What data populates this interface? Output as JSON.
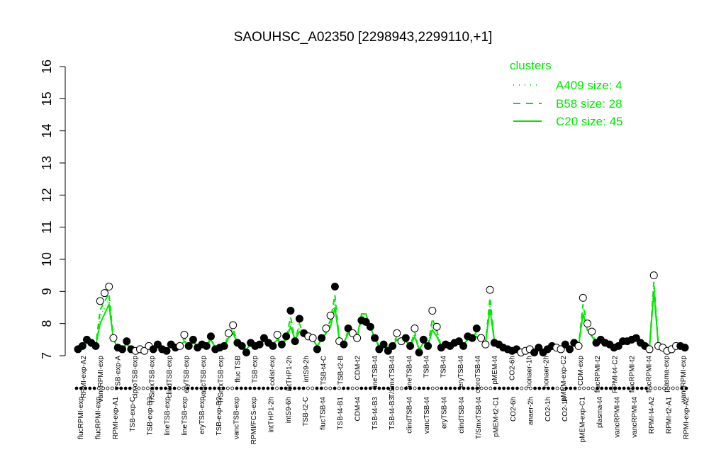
{
  "chart_data": {
    "type": "line",
    "title": "SAOUHSC_A02350 [2298943,2299110,+1]",
    "xlabel": "",
    "ylabel": "",
    "ylim": [
      7,
      16
    ],
    "y_ticks": [
      7,
      8,
      9,
      10,
      11,
      12,
      13,
      14,
      15,
      16
    ],
    "grid": false,
    "legend": {
      "position": "top-right",
      "title": "clusters",
      "entries": [
        {
          "label": "A409 size: 4",
          "style": "dotted"
        },
        {
          "label": "B58 size: 28",
          "style": "dashed"
        },
        {
          "label": "C20 size: 45",
          "style": "solid"
        }
      ]
    },
    "series_color": "#00e600",
    "top_labels": [
      "RPMI-exp-A2",
      "vancRPMI-exp",
      "TSB-exp-A",
      "ciproTSB-exp",
      "T/SmxTSB-exp",
      "clindTSB-exp",
      "eryTSB-exp",
      "vancTSB-exp",
      "T/SmxTSB-exp",
      "fluc TSB",
      "TSB-exp",
      "colist-exp",
      "intTHP1-2h",
      "intS9-2h",
      "TSB-t4-C",
      "TSB-t2-B",
      "CDM-t2",
      "lineTSB-t4",
      "T/SmxTSB-t4",
      "lineTSB-t4",
      "TSB-t4",
      "TSB-t4",
      "eryTSB-t4",
      "ciproTSB-t4",
      "pMEM-t4",
      "CO2-6h",
      "nonaer-1h",
      "nonaer-2h",
      "pMEM-exp-C2",
      "CDM-exp",
      "flucRPMI-t2",
      "RPMI-t4-C2",
      "flucRPMI-t2",
      "flucRPMI-t4",
      "plasma-exp",
      "vancRPMI-exp"
    ],
    "bottom_labels": [
      "flucRPMI-exp",
      "flucRPMI-exp",
      "RPMI-exp-A1",
      "TSB-exp-C",
      "TSB-exp-B3",
      "lineTSB-exp",
      "lineTSB-exp",
      "eryTSB-exp",
      "TSB-exp-B2",
      "vancTSB-exp",
      "RPMI/FCS-exp",
      "intTHP1-2h",
      "intS9-6h",
      "TSB-t2-C",
      "flucTSB-t4",
      "TSB-t4-B1",
      "CDM-t4",
      "TSB-t4-B3",
      "TSB-t4-B3",
      "clindTSB-t4",
      "vancTSB-t4",
      "eryTSB-t4",
      "clindTSB-t4",
      "T/SmxTSB-t4",
      "pMEM-t2-C1",
      "CO2-6h",
      "anaer-2h",
      "CO2-1h",
      "CO2-1h",
      "pMEM-exp-C1",
      "plasma-t4",
      "vancRPMI-t4",
      "vancRPMI-t4",
      "RPMI-t4-A2",
      "RPMI-t2-A1",
      "RPMI-exp-A2"
    ],
    "points": [
      7.2,
      7.3,
      7.5,
      7.4,
      7.3,
      8.7,
      8.95,
      9.15,
      7.55,
      7.25,
      7.2,
      7.45,
      7.2,
      7.15,
      7.2,
      7.15,
      7.3,
      7.2,
      7.35,
      7.2,
      7.15,
      7.35,
      7.25,
      7.3,
      7.65,
      7.3,
      7.5,
      7.25,
      7.35,
      7.3,
      7.6,
      7.2,
      7.25,
      7.3,
      7.7,
      7.95,
      7.4,
      7.3,
      7.1,
      7.4,
      7.3,
      7.35,
      7.55,
      7.4,
      7.3,
      7.65,
      7.35,
      7.6,
      8.4,
      7.45,
      8.15,
      7.7,
      7.6,
      7.55,
      7.2,
      7.55,
      7.85,
      8.25,
      9.15,
      7.45,
      7.35,
      7.85,
      7.7,
      7.55,
      8.1,
      8.05,
      7.9,
      7.55,
      7.2,
      7.35,
      7.15,
      7.3,
      7.7,
      7.45,
      7.55,
      7.3,
      7.85,
      7.1,
      7.5,
      7.3,
      8.4,
      7.9,
      7.25,
      7.35,
      7.3,
      7.4,
      7.45,
      7.3,
      7.6,
      7.55,
      7.85,
      7.55,
      7.35,
      9.05,
      7.4,
      7.35,
      7.25,
      7.2,
      7.15,
      7.2,
      7.1,
      7.15,
      7.2,
      7.1,
      7.25,
      7.1,
      7.2,
      7.3,
      7.25,
      7.2,
      7.35,
      7.2,
      7.4,
      7.3,
      8.8,
      8.0,
      7.75,
      7.4,
      7.5,
      7.4,
      7.35,
      7.25,
      7.3,
      7.45,
      7.45,
      7.5,
      7.55,
      7.4,
      7.3,
      7.2,
      9.5,
      7.3,
      7.25,
      7.15,
      7.2,
      7.3,
      7.3,
      7.25
    ],
    "open_points": [
      5,
      6,
      7,
      8,
      13,
      14,
      15,
      16,
      23,
      24,
      34,
      35,
      45,
      52,
      53,
      56,
      57,
      59,
      62,
      63,
      72,
      73,
      76,
      80,
      81,
      91,
      92,
      93,
      100,
      101,
      102,
      108,
      109,
      113,
      114,
      115,
      116,
      129,
      130,
      131,
      132,
      133,
      134,
      135
    ],
    "c20_line": [
      7.2,
      7.25,
      7.4,
      7.35,
      7.3,
      8.0,
      8.3,
      8.6,
      7.5,
      7.25,
      7.2,
      7.35,
      7.2,
      7.15,
      7.2,
      7.2,
      7.25,
      7.2,
      7.3,
      7.25,
      7.2,
      7.3,
      7.25,
      7.3,
      7.45,
      7.3,
      7.4,
      7.3,
      7.3,
      7.3,
      7.5,
      7.25,
      7.25,
      7.3,
      7.55,
      7.7,
      7.4,
      7.3,
      7.2,
      7.35,
      7.3,
      7.35,
      7.45,
      7.4,
      7.35,
      7.5,
      7.35,
      7.5,
      7.9,
      7.5,
      7.75,
      7.6,
      7.55,
      7.5,
      7.3,
      7.5,
      7.7,
      7.9,
      8.5,
      7.5,
      7.4,
      7.7,
      7.6,
      7.55,
      8.3,
      8.3,
      7.9,
      7.55,
      7.3,
      7.35,
      7.25,
      7.3,
      7.5,
      7.4,
      7.45,
      7.3,
      7.6,
      7.2,
      7.4,
      7.3,
      7.8,
      7.6,
      7.3,
      7.35,
      7.3,
      7.35,
      7.4,
      7.35,
      7.5,
      7.5,
      7.6,
      7.5,
      7.4,
      8.45,
      7.45,
      7.35,
      7.25,
      7.2,
      7.2,
      7.2,
      7.15,
      7.15,
      7.2,
      7.15,
      7.2,
      7.15,
      7.2,
      7.25,
      7.25,
      7.2,
      7.3,
      7.25,
      7.35,
      7.3,
      8.3,
      7.8,
      7.6,
      7.4,
      7.45,
      7.4,
      7.35,
      7.3,
      7.3,
      7.4,
      7.4,
      7.45,
      7.5,
      7.4,
      7.3,
      7.25,
      9.0,
      7.35,
      7.25,
      7.2,
      7.2,
      7.25,
      7.3,
      7.25
    ]
  }
}
